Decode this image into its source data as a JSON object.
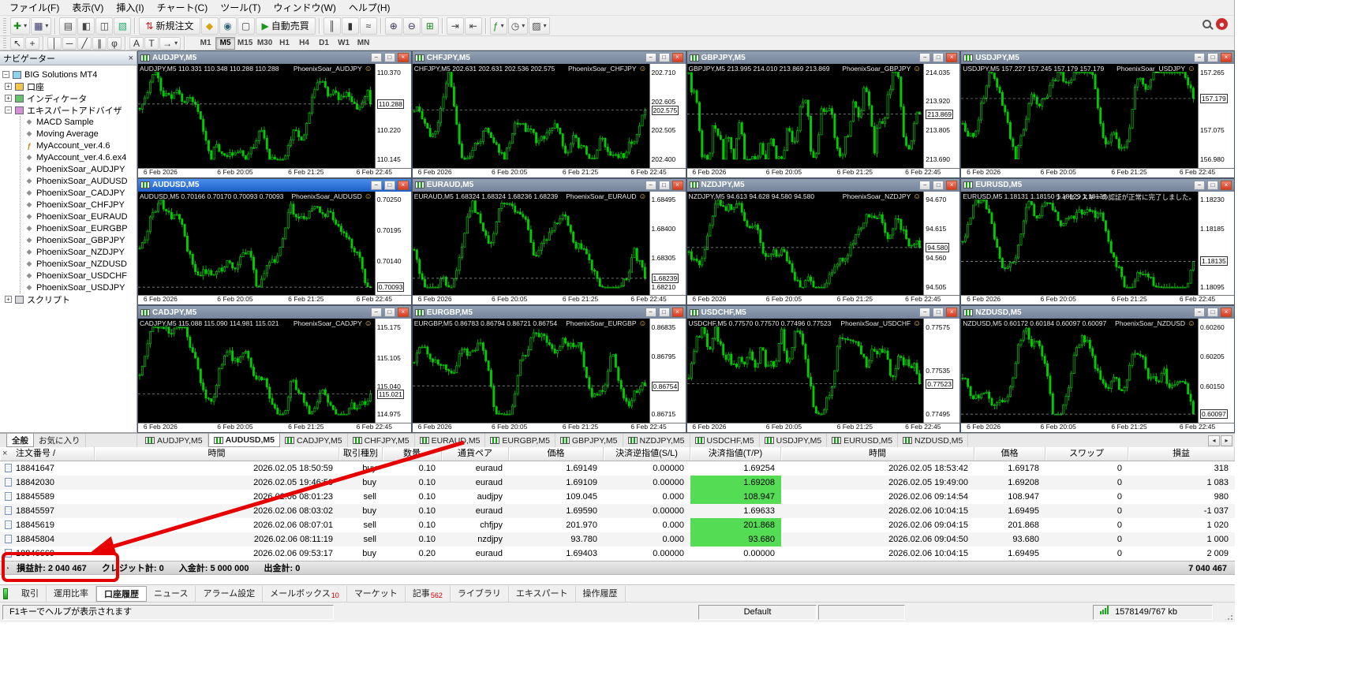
{
  "colors": {
    "accent_red": "#e60000",
    "chart_green": "#00cc00",
    "tp_hit_green": "#55dc55",
    "active_title_blue": "#1d5ec7",
    "chart_background": "#000000"
  },
  "menu": {
    "items": [
      "ファイル(F)",
      "表示(V)",
      "挿入(I)",
      "チャート(C)",
      "ツール(T)",
      "ウィンドウ(W)",
      "ヘルプ(H)"
    ]
  },
  "toolbar_main": {
    "buttons": [
      {
        "name": "new-chart-button",
        "glyph": "✚",
        "tint": "#1a8a1a",
        "caret": true
      },
      {
        "name": "profiles-button",
        "glyph": "▦",
        "tint": "#336",
        "caret": true
      },
      {
        "name": "sep"
      },
      {
        "name": "toolbox-button",
        "glyph": "▤",
        "tint": "#444"
      },
      {
        "name": "navigator-button",
        "glyph": "◧",
        "tint": "#444"
      },
      {
        "name": "data-window-button",
        "glyph": "◫",
        "tint": "#444"
      },
      {
        "name": "strategy-tester-button",
        "glyph": "▧",
        "tint": "#2a6"
      },
      {
        "name": "sep"
      },
      {
        "name": "new-order-button",
        "glyph": "⇅",
        "tint": "#c22",
        "label": "新規注文"
      },
      {
        "name": "metaeditor-button",
        "glyph": "◆",
        "tint": "#d9a410"
      },
      {
        "name": "sound-button",
        "glyph": "◉",
        "tint": "#367"
      },
      {
        "name": "fullscreen-button",
        "glyph": "▢",
        "tint": "#444"
      },
      {
        "name": "autotrading-button",
        "glyph": "▶",
        "tint": "#1a9a1a",
        "label": "自動売買"
      },
      {
        "name": "sep"
      },
      {
        "name": "bar-chart-button",
        "glyph": "║",
        "tint": "#333"
      },
      {
        "name": "candlestick-button",
        "glyph": "▮",
        "tint": "#333"
      },
      {
        "name": "line-chart-button",
        "glyph": "≈",
        "tint": "#333"
      },
      {
        "name": "sep"
      },
      {
        "name": "zoom-in-button",
        "glyph": "⊕",
        "tint": "#335"
      },
      {
        "name": "zoom-out-button",
        "glyph": "⊖",
        "tint": "#335"
      },
      {
        "name": "tile-windows-button",
        "glyph": "⊞",
        "tint": "#1a8a1a"
      },
      {
        "name": "sep"
      },
      {
        "name": "auto-scroll-button",
        "glyph": "⇥",
        "tint": "#444"
      },
      {
        "name": "chart-shift-button",
        "glyph": "⇤",
        "tint": "#444"
      },
      {
        "name": "sep"
      },
      {
        "name": "indicators-button",
        "glyph": "ƒ",
        "tint": "#1a8a1a",
        "caret": true
      },
      {
        "name": "periods-button",
        "glyph": "◷",
        "tint": "#444",
        "caret": true
      },
      {
        "name": "templates-button",
        "glyph": "▨",
        "tint": "#444",
        "caret": true
      }
    ]
  },
  "toolbar_draw": {
    "buttons": [
      {
        "name": "cursor-button",
        "glyph": "↖",
        "tint": "#333"
      },
      {
        "name": "crosshair-button",
        "glyph": "+",
        "tint": "#333"
      },
      {
        "name": "sep"
      },
      {
        "name": "vertical-line-button",
        "glyph": "│",
        "tint": "#333"
      },
      {
        "name": "horizontal-line-button",
        "glyph": "─",
        "tint": "#333"
      },
      {
        "name": "trendline-button",
        "glyph": "╱",
        "tint": "#333"
      },
      {
        "name": "channel-button",
        "glyph": "∥",
        "tint": "#333"
      },
      {
        "name": "fibonacci-button",
        "glyph": "φ",
        "tint": "#333"
      },
      {
        "name": "sep"
      },
      {
        "name": "text-button",
        "glyph": "A",
        "tint": "#333"
      },
      {
        "name": "text-label-button",
        "glyph": "T",
        "tint": "#333"
      },
      {
        "name": "arrows-button",
        "glyph": "→",
        "tint": "#333",
        "caret": true
      },
      {
        "name": "sep"
      }
    ],
    "timeframes": [
      "M1",
      "M5",
      "M15",
      "M30",
      "H1",
      "H4",
      "D1",
      "W1",
      "MN"
    ],
    "active_timeframe": "M5"
  },
  "navigator": {
    "title": "ナビゲーター",
    "tabs": [
      "全般",
      "お気に入り"
    ],
    "active_tab": "全般",
    "tree": {
      "root": "BIG Solutions MT4",
      "items": [
        {
          "label": "口座",
          "icon": "accounts-icon",
          "expanded": false
        },
        {
          "label": "インディケータ",
          "icon": "indicators-icon",
          "expanded": false
        },
        {
          "label": "エキスパートアドバイザ",
          "icon": "experts-icon",
          "expanded": true,
          "children": [
            {
              "label": "MACD Sample",
              "icon": "ea-icon"
            },
            {
              "label": "Moving Average",
              "icon": "ea-icon"
            },
            {
              "label": "MyAccount_ver.4.6",
              "icon": "mq4-icon"
            },
            {
              "label": "MyAccount_ver.4.6.ex4",
              "icon": "ea-icon"
            },
            {
              "label": "PhoenixSoar_AUDJPY",
              "icon": "ea-icon"
            },
            {
              "label": "PhoenixSoar_AUDUSD",
              "icon": "ea-icon"
            },
            {
              "label": "PhoenixSoar_CADJPY",
              "icon": "ea-icon"
            },
            {
              "label": "PhoenixSoar_CHFJPY",
              "icon": "ea-icon"
            },
            {
              "label": "PhoenixSoar_EURAUD",
              "icon": "ea-icon"
            },
            {
              "label": "PhoenixSoar_EURGBP",
              "icon": "ea-icon"
            },
            {
              "label": "PhoenixSoar_GBPJPY",
              "icon": "ea-icon"
            },
            {
              "label": "PhoenixSoar_NZDJPY",
              "icon": "ea-icon"
            },
            {
              "label": "PhoenixSoar_NZDUSD",
              "icon": "ea-icon"
            },
            {
              "label": "PhoenixSoar_USDCHF",
              "icon": "ea-icon"
            },
            {
              "label": "PhoenixSoar_USDJPY",
              "icon": "ea-icon"
            }
          ]
        },
        {
          "label": "スクリプト",
          "icon": "scripts-icon",
          "expanded": false
        }
      ]
    }
  },
  "window_buttons": [
    {
      "name": "minimize-button",
      "glyph": "−"
    },
    {
      "name": "restore-button",
      "glyph": "□"
    },
    {
      "name": "close-button",
      "glyph": "×"
    }
  ],
  "chart_time_labels": [
    "6 Feb 2026",
    "6 Feb 20:05",
    "6 Feb 21:25",
    "6 Feb 22:45"
  ],
  "charts": [
    {
      "title": "AUDJPY,M5",
      "ohlc": "AUDJPY,M5 110.331 110.348 110.288 110.288",
      "ea_label": "PhoenixSoar_AUDJPY",
      "smiley": "☺",
      "scale": [
        "110.370",
        "110.288",
        "110.220",
        "110.145"
      ],
      "current": "110.288",
      "active": false
    },
    {
      "title": "CHFJPY,M5",
      "ohlc": "CHFJPY,M5 202.631 202.631 202.536 202.575",
      "ea_label": "PhoenixSoar_CHFJPY",
      "smiley": "☺",
      "scale": [
        "202.710",
        "202.605",
        "202.575",
        "202.505",
        "202.400"
      ],
      "current": "202.575",
      "active": false
    },
    {
      "title": "GBPJPY,M5",
      "ohlc": "GBPJPY,M5 213.995 214.010 213.869 213.869",
      "ea_label": "PhoenixSoar_GBPJPY",
      "smiley": "☺",
      "scale": [
        "214.035",
        "213.920",
        "213.869",
        "213.805",
        "213.690"
      ],
      "current": "213.869",
      "active": false
    },
    {
      "title": "USDJPY,M5",
      "ohlc": "USDJPY,M5 157.227 157.245 157.179 157.179",
      "ea_label": "PhoenixSoar_USDJPY",
      "smiley": "☺",
      "scale": [
        "157.265",
        "157.179",
        "157.075",
        "156.980"
      ],
      "current": "157.179",
      "active": false
    },
    {
      "title": "AUDUSD,M5",
      "ohlc": "AUDUSD,M5 0.70166 0.70170 0.70093 0.70093",
      "ea_label": "PhoenixSoar_AUDUSD",
      "smiley": "☺",
      "scale": [
        "0.70250",
        "0.70195",
        "0.70140",
        "0.70093"
      ],
      "current": "0.70093",
      "active": true
    },
    {
      "title": "EURAUD,M5",
      "ohlc": "EURAUD,M5 1.68324 1.68324 1.68236 1.68239",
      "ea_label": "PhoenixSoar_EURAUD",
      "smiley": "☺",
      "scale": [
        "1.68495",
        "1.68400",
        "1.68305",
        "1.68239",
        "1.68210"
      ],
      "current": "1.68239",
      "active": false
    },
    {
      "title": "NZDJPY,M5",
      "ohlc": "NZDJPY,M5 94.613 94.628 94.580 94.580",
      "ea_label": "PhoenixSoar_NZDJPY",
      "smiley": "☺",
      "scale": [
        "94.670",
        "94.615",
        "94.580",
        "94.560",
        "94.505"
      ],
      "current": "94.580",
      "active": false
    },
    {
      "title": "EURUSD,M5",
      "ohlc": "EURUSD,M5 1.18131 1.18150 1.18129 1.18135",
      "ea_label": "ライセンスキーの認証が正常に完了しました。",
      "smiley": "",
      "scale": [
        "1.18230",
        "1.18185",
        "1.18135",
        "1.18095"
      ],
      "current": "1.18135",
      "active": false
    },
    {
      "title": "CADJPY,M5",
      "ohlc": "CADJPY,M5 115.088 115.090 114.981 115.021",
      "ea_label": "PhoenixSoar_CADJPY",
      "smiley": "☺",
      "scale": [
        "115.175",
        "115.105",
        "115.040",
        "115.021",
        "114.975"
      ],
      "current": "115.021",
      "active": false
    },
    {
      "title": "EURGBP,M5",
      "ohlc": "EURGBP,M5 0.86783 0.86794 0.86721 0.86754",
      "ea_label": "PhoenixSoar_EURGBP",
      "smiley": "☺",
      "scale": [
        "0.86835",
        "0.86795",
        "0.86754",
        "0.86715"
      ],
      "current": "0.86754",
      "active": false
    },
    {
      "title": "USDCHF,M5",
      "ohlc": "USDCHF,M5 0.77570 0.77570 0.77496 0.77523",
      "ea_label": "PhoenixSoar_USDCHF",
      "smiley": "☺",
      "scale": [
        "0.77575",
        "0.77535",
        "0.77523",
        "0.77495"
      ],
      "current": "0.77523",
      "active": false
    },
    {
      "title": "NZDUSD,M5",
      "ohlc": "NZDUSD,M5 0.60172 0.60184 0.60097 0.60097",
      "ea_label": "PhoenixSoar_NZDUSD",
      "smiley": "☺",
      "scale": [
        "0.60260",
        "0.60205",
        "0.60150",
        "0.60097"
      ],
      "current": "0.60097",
      "active": false
    }
  ],
  "chart_tabs": {
    "items": [
      "AUDJPY,M5",
      "AUDUSD,M5",
      "CADJPY,M5",
      "CHFJPY,M5",
      "EURAUD,M5",
      "EURGBP,M5",
      "GBPJPY,M5",
      "NZDJPY,M5",
      "USDCHF,M5",
      "USDJPY,M5",
      "EURUSD,M5",
      "NZDUSD,M5"
    ],
    "active": "AUDUSD,M5"
  },
  "terminal": {
    "headers": [
      "注文番号 /",
      "時間",
      "取引種別",
      "数量",
      "通貨ペア",
      "価格",
      "決済逆指値(S/L)",
      "決済指値(T/P)",
      "時間",
      "価格",
      "スワップ",
      "損益"
    ],
    "rows": [
      {
        "order": "18841647",
        "open_time": "2026.02.05 18:50:59",
        "type": "buy",
        "volume": "0.10",
        "symbol": "euraud",
        "open_price": "1.69149",
        "sl": "0.00000",
        "tp": "1.69254",
        "tp_hit": false,
        "close_time": "2026.02.05 18:53:42",
        "close_price": "1.69178",
        "swap": "0",
        "profit": "318"
      },
      {
        "order": "18842030",
        "open_time": "2026.02.05 19:46:50",
        "type": "buy",
        "volume": "0.10",
        "symbol": "euraud",
        "open_price": "1.69109",
        "sl": "0.00000",
        "tp": "1.69208",
        "tp_hit": true,
        "close_time": "2026.02.05 19:49:00",
        "close_price": "1.69208",
        "swap": "0",
        "profit": "1 083"
      },
      {
        "order": "18845589",
        "open_time": "2026.02.06 08:01:23",
        "type": "sell",
        "volume": "0.10",
        "symbol": "audjpy",
        "open_price": "109.045",
        "sl": "0.000",
        "tp": "108.947",
        "tp_hit": true,
        "close_time": "2026.02.06 09:14:54",
        "close_price": "108.947",
        "swap": "0",
        "profit": "980"
      },
      {
        "order": "18845597",
        "open_time": "2026.02.06 08:03:02",
        "type": "buy",
        "volume": "0.10",
        "symbol": "euraud",
        "open_price": "1.69590",
        "sl": "0.00000",
        "tp": "1.69633",
        "tp_hit": false,
        "close_time": "2026.02.06 10:04:15",
        "close_price": "1.69495",
        "swap": "0",
        "profit": "-1 037"
      },
      {
        "order": "18845619",
        "open_time": "2026.02.06 08:07:01",
        "type": "sell",
        "volume": "0.10",
        "symbol": "chfjpy",
        "open_price": "201.970",
        "sl": "0.000",
        "tp": "201.868",
        "tp_hit": true,
        "close_time": "2026.02.06 09:04:15",
        "close_price": "201.868",
        "swap": "0",
        "profit": "1 020"
      },
      {
        "order": "18845804",
        "open_time": "2026.02.06 08:11:19",
        "type": "sell",
        "volume": "0.10",
        "symbol": "nzdjpy",
        "open_price": "93.780",
        "sl": "0.000",
        "tp": "93.680",
        "tp_hit": true,
        "close_time": "2026.02.06 09:04:50",
        "close_price": "93.680",
        "swap": "0",
        "profit": "1 000"
      },
      {
        "order": "18846669",
        "open_time": "2026.02.06 09:53:17",
        "type": "buy",
        "volume": "0.20",
        "symbol": "euraud",
        "open_price": "1.69403",
        "sl": "0.00000",
        "tp": "0.00000",
        "tp_hit": false,
        "close_time": "2026.02.06 10:04:15",
        "close_price": "1.69495",
        "swap": "0",
        "profit": "2 009"
      }
    ],
    "summary": {
      "profit_label": "損益計:",
      "profit": "2 040 467",
      "credit_label": "クレジット計:",
      "credit": "0",
      "deposit_label": "入金計:",
      "deposit": "5 000 000",
      "withdrawal_label": "出金計:",
      "withdrawal": "0",
      "balance": "7 040 467"
    },
    "tabs": [
      {
        "label": "取引"
      },
      {
        "label": "運用比率"
      },
      {
        "label": "口座履歴",
        "active": true
      },
      {
        "label": "ニュース"
      },
      {
        "label": "アラーム設定"
      },
      {
        "label": "メールボックス",
        "badge": "10"
      },
      {
        "label": "マーケット"
      },
      {
        "label": "記事",
        "badge": "562"
      },
      {
        "label": "ライブラリ"
      },
      {
        "label": "エキスパート"
      },
      {
        "label": "操作履歴"
      }
    ]
  },
  "status_bar": {
    "help": "F1キーでヘルプが表示されます",
    "profile": "Default",
    "traffic": "1578149/767 kb"
  },
  "annotation": {
    "type": "red-box-and-arrow",
    "target": "profit-total",
    "color": "#e60000"
  }
}
